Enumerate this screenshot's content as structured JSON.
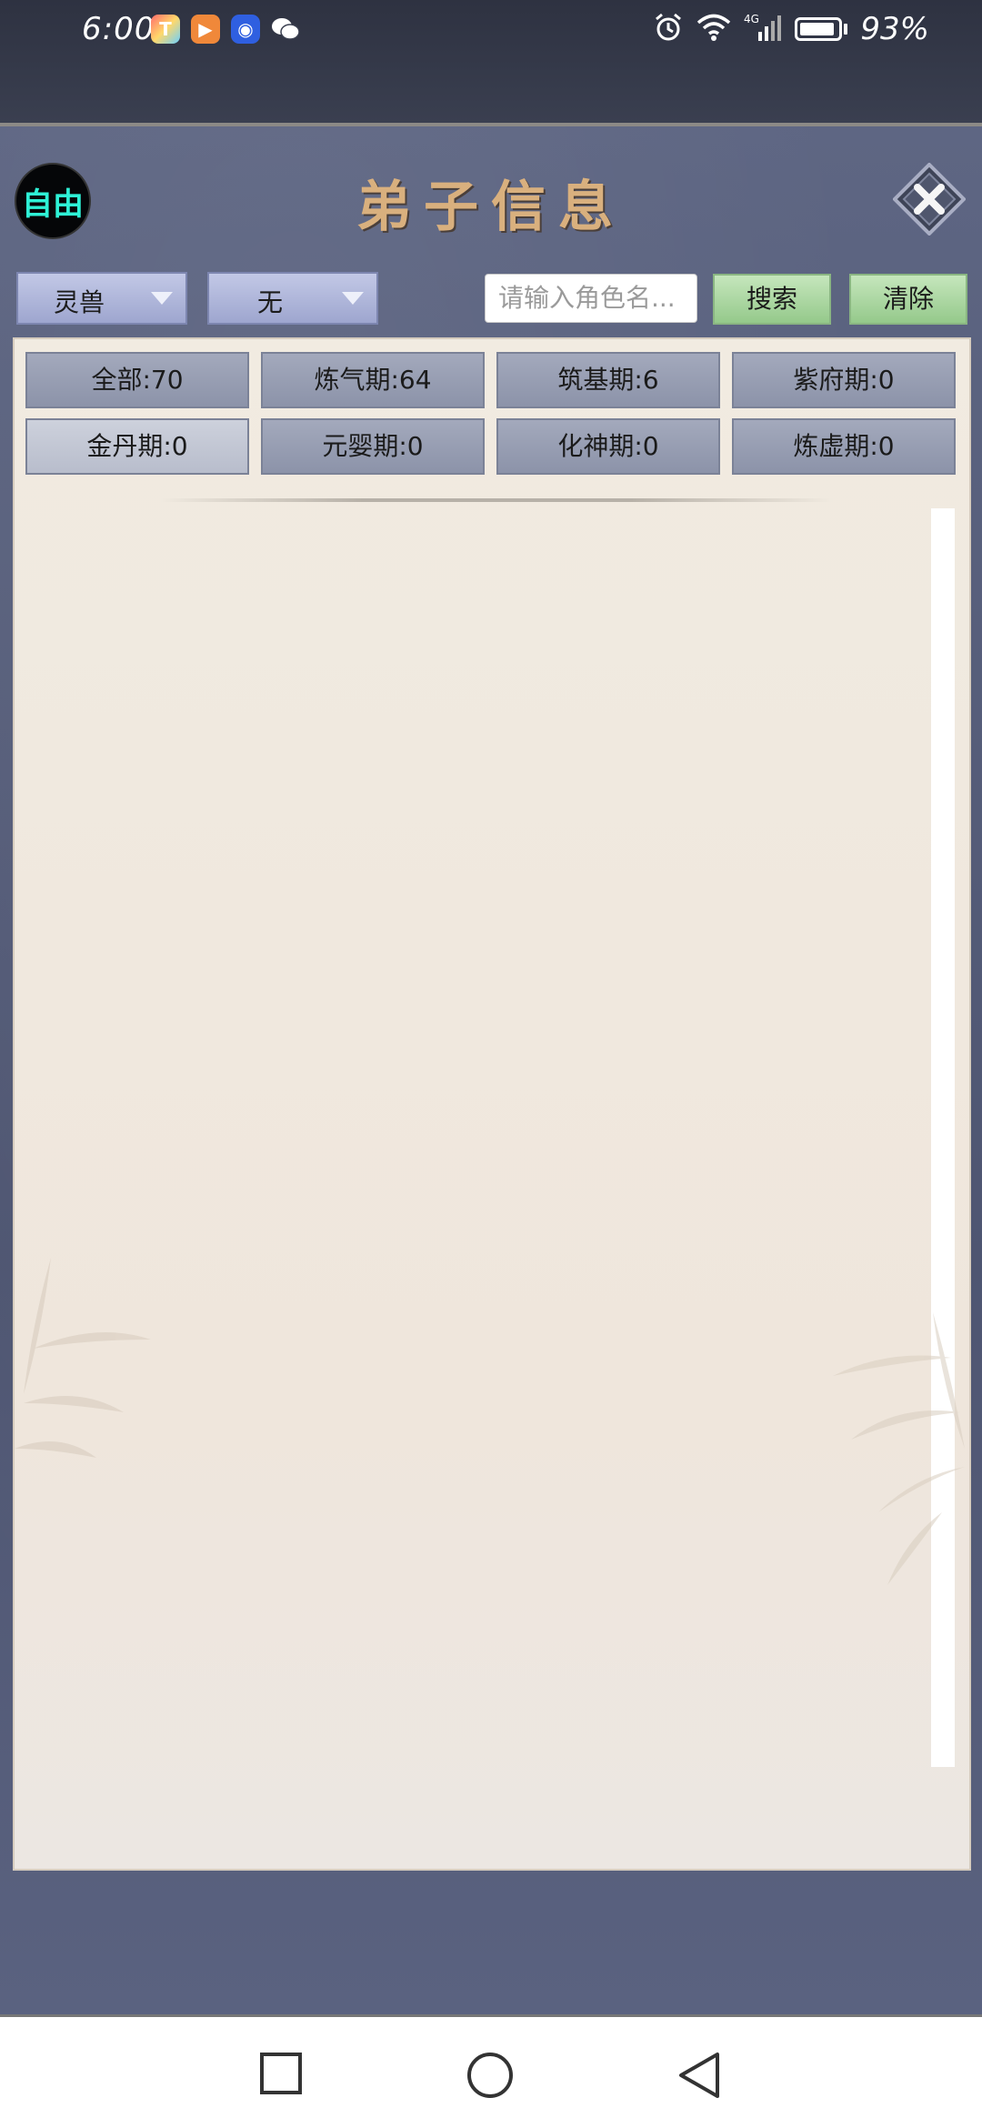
{
  "status_bar": {
    "time": "6:00",
    "battery_text": "93%",
    "battery_level": 0.93,
    "apps": [
      "toutiao-icon",
      "video-icon",
      "bulb-icon",
      "wechat-icon"
    ],
    "indicators": [
      "alarm-icon",
      "wifi-icon",
      "signal-4g-icon",
      "battery-icon"
    ]
  },
  "header": {
    "free_badge": "自由",
    "title": "弟子信息"
  },
  "filters": {
    "dropdown_type": "灵兽",
    "dropdown_sub": "无",
    "search_placeholder": "请输入角色名...",
    "search_button": "搜索",
    "clear_button": "清除"
  },
  "tabs": [
    {
      "label": "全部:70"
    },
    {
      "label": "炼气期:64"
    },
    {
      "label": "筑基期:6"
    },
    {
      "label": "紫府期:0"
    },
    {
      "label": "金丹期:0"
    },
    {
      "label": "元婴期:0"
    },
    {
      "label": "化神期:0"
    },
    {
      "label": "炼虚期:0"
    }
  ],
  "colors": {
    "title": "#d9b07e",
    "badge_text": "#2ef2d6",
    "panel": "#f1ebe1",
    "green_button": "#a9d6a0",
    "dropdown": "#b0b7dc"
  },
  "nav": [
    "recent-apps-icon",
    "home-icon",
    "back-icon"
  ]
}
